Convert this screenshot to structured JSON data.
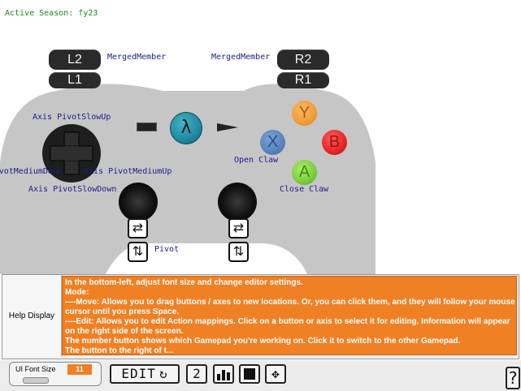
{
  "header": {
    "season_label": "Active Season: fy23"
  },
  "shoulders": {
    "l2": {
      "label": "L2",
      "mapping": "MergedMember"
    },
    "l1": {
      "label": "L1"
    },
    "r2": {
      "label": "R2",
      "mapping": "MergedMember"
    },
    "r1": {
      "label": "R1"
    }
  },
  "face_buttons": {
    "y": {
      "label": "Y",
      "color": "#f2a03a"
    },
    "x": {
      "label": "X",
      "color": "#5a86bf",
      "mapping": "Open Claw"
    },
    "b": {
      "label": "B",
      "color": "#e82a2a"
    },
    "a": {
      "label": "A",
      "color": "#7fd03f",
      "mapping": "Close Claw"
    }
  },
  "center": {
    "logo_label": "λ"
  },
  "dpad_labels": {
    "up": "Axis PivotSlowUp",
    "left": "Axis PivotMediumDown",
    "right": "Axis PivotMediumUp",
    "down": "Axis PivotSlowDown"
  },
  "sticks": {
    "right_stick_mapping": "Pivot"
  },
  "help": {
    "label": "Help Display",
    "lines": [
      "In the bottom-left, adjust font size and change editor settings.",
      "Mode:",
      "----Move: Allows you to drag buttons / axes to new locations. Or, you can click them, and they will follow your mouse",
      "cursor until you press Space.",
      "----Edit: Allows you to edit Action mappings. Click on a button or axis to select it for editing. Information will appear",
      "on the right side of the screen.",
      "The number button shows which Gamepad you're working on. Click it to switch to the other Gamepad.",
      "The button to the right of t..."
    ]
  },
  "footer": {
    "font_size_label": "UI Font Size",
    "font_size_value": "11",
    "mode_label": "EDIT",
    "gamepad_number": "2",
    "help_button": "?"
  },
  "colors": {
    "accent": "#f08024",
    "controller_body": "#c8c8c8"
  }
}
